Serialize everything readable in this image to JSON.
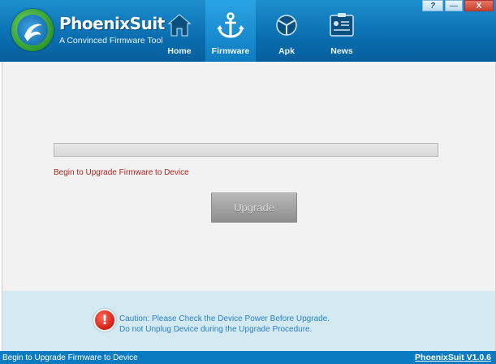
{
  "app": {
    "name": "PhoenixSuit",
    "tagline": "A Convinced Firmware Tool"
  },
  "nav": {
    "items": [
      {
        "label": "Home",
        "icon": "home-icon"
      },
      {
        "label": "Firmware",
        "icon": "anchor-icon",
        "active": true
      },
      {
        "label": "Apk",
        "icon": "apk-icon"
      },
      {
        "label": "News",
        "icon": "news-icon"
      }
    ]
  },
  "window_controls": {
    "help": "?",
    "minimize": "—",
    "close": "X"
  },
  "main": {
    "progress": 0,
    "status_message": "Begin to Upgrade Firmware to Device",
    "upgrade_button": "Upgrade",
    "upgrade_enabled": false
  },
  "caution": {
    "icon": "exclamation-icon",
    "glyph": "!",
    "line1": "Caution: Please Check the Device Power Before Upgrade.",
    "line2": "Do not Unplug Device during the Upgrade Procedure."
  },
  "statusbar": {
    "text": "Begin to Upgrade Firmware to Device",
    "version": "PhoenixSuit V1.0.6"
  },
  "colors": {
    "header": "#0a6eb0",
    "status_message": "#b3231f",
    "caution_text": "#2b7fc3",
    "statusbar": "#0b7bc1"
  }
}
